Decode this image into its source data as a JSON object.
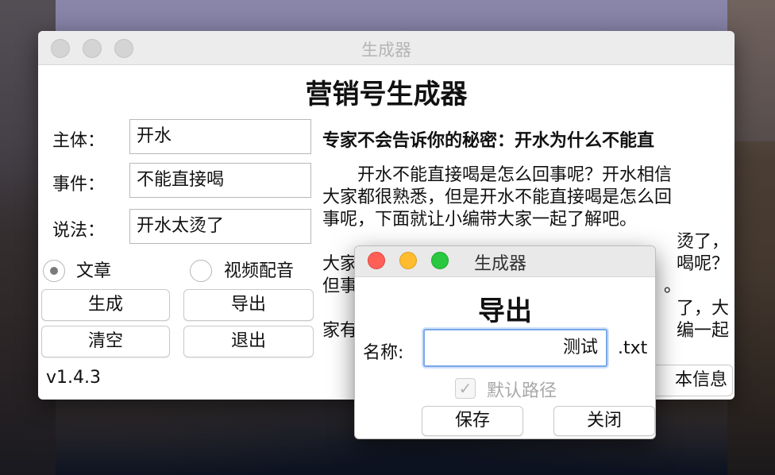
{
  "main_window": {
    "title": "生成器",
    "heading": "营销号生成器",
    "fields": [
      {
        "label": "主体：",
        "value": "开水"
      },
      {
        "label": "事件：",
        "value": "不能直接喝"
      },
      {
        "label": "说法：",
        "value": "开水太烫了"
      }
    ],
    "radio": {
      "article_label": "文章",
      "video_label": "视频配音",
      "selected": "文章"
    },
    "buttons": {
      "generate": "生成",
      "export": "导出",
      "clear": "清空",
      "quit": "退出",
      "info_partial": "本信息"
    },
    "version": "v1.4.3",
    "article": {
      "title": "专家不会告诉你的秘密：开水为什么不能直",
      "line1": "开水不能直接喝是怎么回事呢？开水相信",
      "line2": "大家都很熟悉，但是开水不能直接喝是怎么回",
      "line3": "事呢，下面就让小编带大家一起了解吧。",
      "line4_right": "烫了，",
      "line5_left": "大家",
      "line5_right": "喝呢？",
      "line6_left": "但事",
      "line6_right": "。",
      "line7_right": "了，大",
      "line8_left": "家有",
      "line8_right": "编一起"
    }
  },
  "export_dialog": {
    "title": "生成器",
    "heading": "导出",
    "name_label": "名称:",
    "name_value": "测试",
    "extension": ".txt",
    "default_path_label": "默认路径",
    "default_path_checked": true,
    "save_button": "保存",
    "close_button": "关闭",
    "checkmark": "✓"
  }
}
